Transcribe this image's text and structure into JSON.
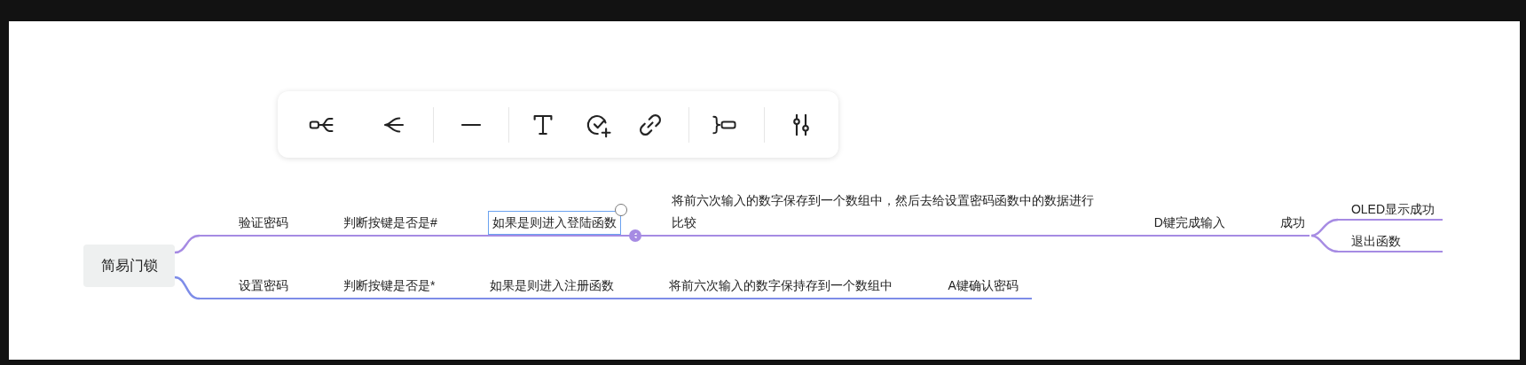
{
  "mind_map": {
    "root": {
      "label": "简易门锁",
      "selected": false,
      "children": [
        {
          "label": "验证密码",
          "selected": false,
          "color": "#a68be3",
          "children": [
            {
              "label": "判断按键是否是#",
              "selected": false,
              "children": [
                {
                  "label": "如果是则进入登陆函数",
                  "selected": true,
                  "children": [
                    {
                      "label": "将前六次输入的数字保存到一个数组中，然后去给设置密码函数中的数据进行比较",
                      "selected": false,
                      "children": [
                        {
                          "label": "D键完成输入",
                          "selected": false,
                          "children": [
                            {
                              "label": "成功",
                              "selected": false,
                              "children": [
                                {
                                  "label": "OLED显示成功",
                                  "selected": false
                                },
                                {
                                  "label": "退出函数",
                                  "selected": false
                                }
                              ]
                            }
                          ]
                        }
                      ]
                    }
                  ]
                }
              ]
            }
          ]
        },
        {
          "label": "设置密码",
          "selected": false,
          "color": "#7e8de8",
          "children": [
            {
              "label": "判断按键是否是*",
              "selected": false,
              "children": [
                {
                  "label": "如果是则进入注册函数",
                  "selected": false,
                  "children": [
                    {
                      "label": "将前六次输入的数字保持存到一个数组中",
                      "selected": false,
                      "children": [
                        {
                          "label": "A键确认密码",
                          "selected": false
                        }
                      ]
                    }
                  ]
                }
              ]
            }
          ]
        }
      ]
    }
  }
}
